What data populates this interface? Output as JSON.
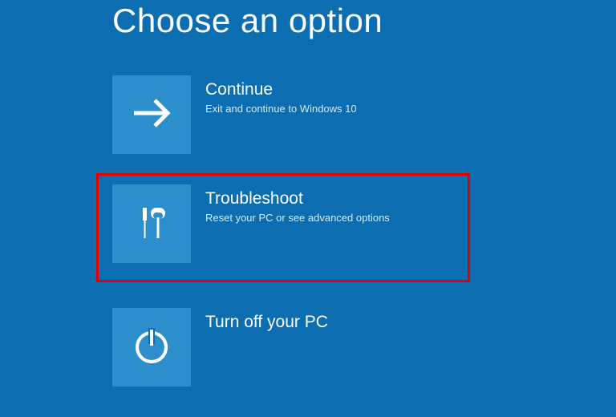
{
  "header": {
    "title": "Choose an option"
  },
  "options": {
    "continue": {
      "title": "Continue",
      "desc": "Exit and continue to Windows 10"
    },
    "troubleshoot": {
      "title": "Troubleshoot",
      "desc": "Reset your PC or see advanced options"
    },
    "poweroff": {
      "title": "Turn off your PC"
    }
  },
  "highlight": "troubleshoot"
}
